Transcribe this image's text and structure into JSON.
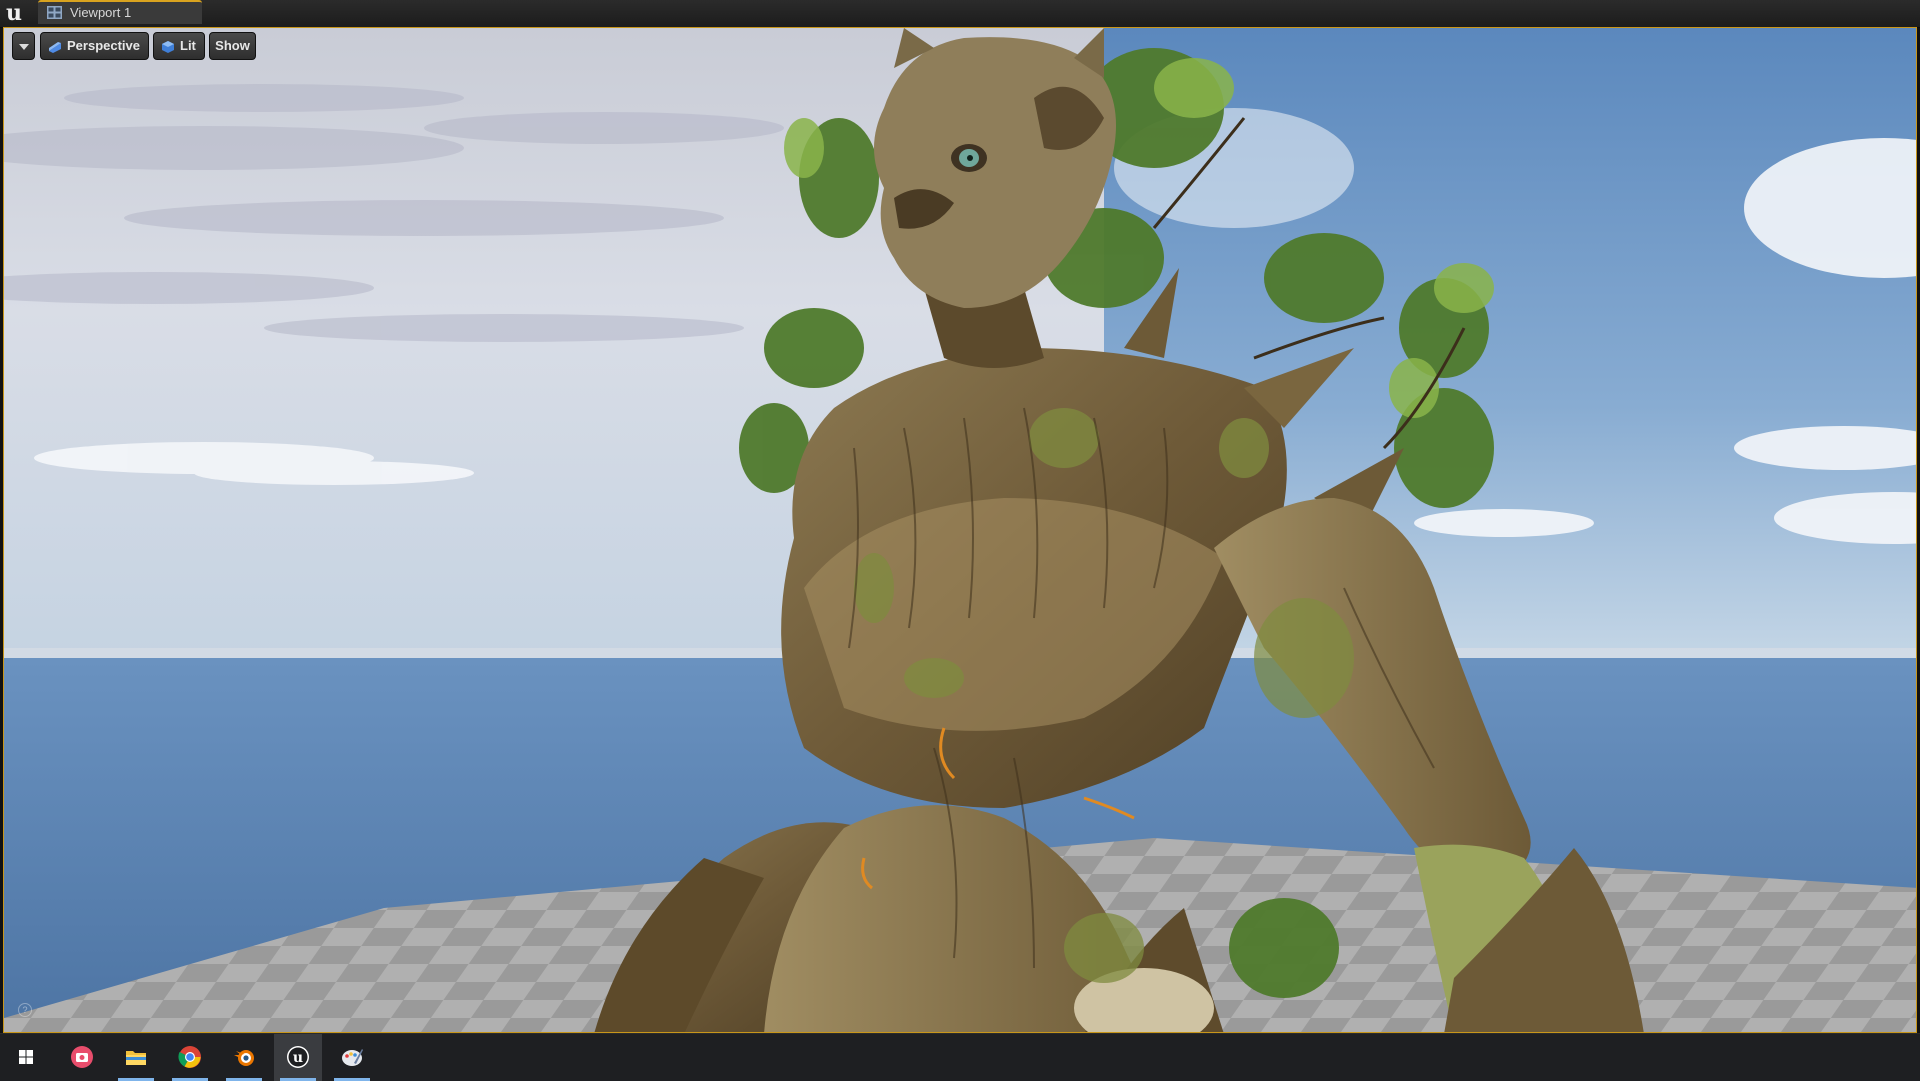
{
  "window": {
    "tab_label": "Viewport 1",
    "logo_icon": "unreal-engine-logo-icon",
    "tab_icon": "viewport-grid-icon",
    "accent_color": "#d9a31f"
  },
  "viewport_toolbar": {
    "dropdown_icon": "chevron-down-icon",
    "perspective_label": "Perspective",
    "perspective_icon": "perspective-camera-icon",
    "lit_label": "Lit",
    "lit_icon": "lit-sphere-icon",
    "show_label": "Show"
  },
  "scene": {
    "subject": "tree creature character model",
    "background": "sky with clouds, water plane, checkered floor"
  },
  "taskbar": {
    "items": [
      {
        "icon": "windows-start-icon",
        "active": false,
        "open": false
      },
      {
        "icon": "screen-recorder-app-icon",
        "active": false,
        "open": false
      },
      {
        "icon": "file-explorer-icon",
        "active": false,
        "open": true
      },
      {
        "icon": "chrome-browser-icon",
        "active": false,
        "open": true
      },
      {
        "icon": "blender-app-icon",
        "active": false,
        "open": true
      },
      {
        "icon": "unreal-engine-app-icon",
        "active": true,
        "open": true
      },
      {
        "icon": "paint-app-icon",
        "active": false,
        "open": true
      }
    ]
  }
}
